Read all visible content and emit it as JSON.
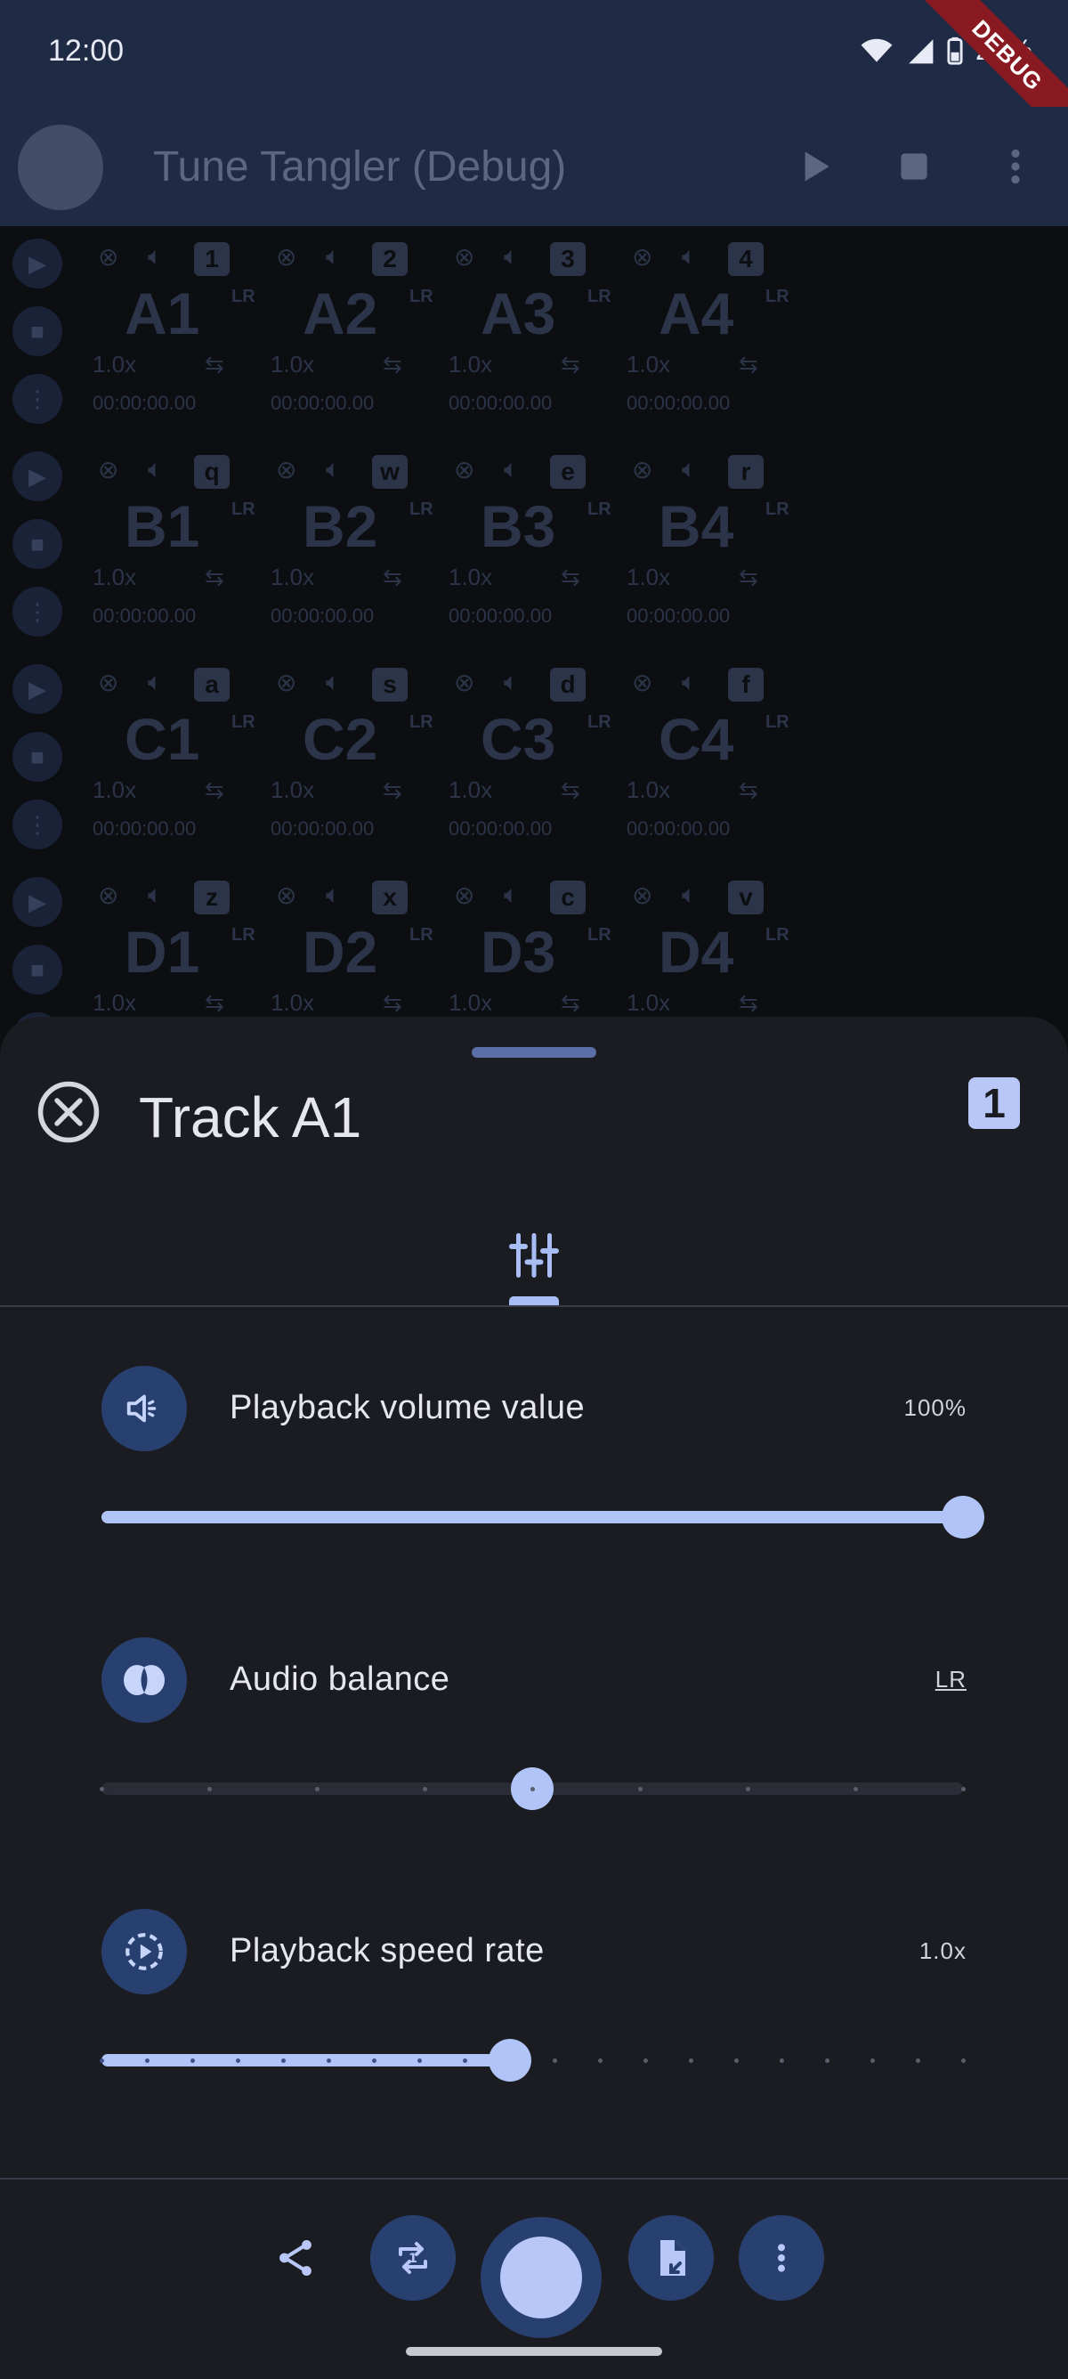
{
  "status_bar": {
    "time": "12:00",
    "battery": "26%",
    "debug_banner": "DEBUG"
  },
  "app_bar": {
    "title": "Tune Tangler (Debug)",
    "logo_text": "Tune Tangler"
  },
  "pads": [
    {
      "name": "A1",
      "key": "1",
      "speed": "1.0x",
      "time": "00:00:00.00",
      "balance": "LR"
    },
    {
      "name": "A2",
      "key": "2",
      "speed": "1.0x",
      "time": "00:00:00.00",
      "balance": "LR"
    },
    {
      "name": "A3",
      "key": "3",
      "speed": "1.0x",
      "time": "00:00:00.00",
      "balance": "LR"
    },
    {
      "name": "A4",
      "key": "4",
      "speed": "1.0x",
      "time": "00:00:00.00",
      "balance": "LR"
    },
    {
      "name": "B1",
      "key": "q",
      "speed": "1.0x",
      "time": "00:00:00.00",
      "balance": "LR"
    },
    {
      "name": "B2",
      "key": "w",
      "speed": "1.0x",
      "time": "00:00:00.00",
      "balance": "LR"
    },
    {
      "name": "B3",
      "key": "e",
      "speed": "1.0x",
      "time": "00:00:00.00",
      "balance": "LR"
    },
    {
      "name": "B4",
      "key": "r",
      "speed": "1.0x",
      "time": "00:00:00.00",
      "balance": "LR"
    },
    {
      "name": "C1",
      "key": "a",
      "speed": "1.0x",
      "time": "00:00:00.00",
      "balance": "LR"
    },
    {
      "name": "C2",
      "key": "s",
      "speed": "1.0x",
      "time": "00:00:00.00",
      "balance": "LR"
    },
    {
      "name": "C3",
      "key": "d",
      "speed": "1.0x",
      "time": "00:00:00.00",
      "balance": "LR"
    },
    {
      "name": "C4",
      "key": "f",
      "speed": "1.0x",
      "time": "00:00:00.00",
      "balance": "LR"
    },
    {
      "name": "D1",
      "key": "z",
      "speed": "1.0x",
      "time": "",
      "balance": "LR"
    },
    {
      "name": "D2",
      "key": "x",
      "speed": "1.0x",
      "time": "",
      "balance": "LR"
    },
    {
      "name": "D3",
      "key": "c",
      "speed": "1.0x",
      "time": "",
      "balance": "LR"
    },
    {
      "name": "D4",
      "key": "v",
      "speed": "1.0x",
      "time": "",
      "balance": "LR"
    }
  ],
  "sheet": {
    "title": "Track A1",
    "key": "1",
    "settings": {
      "volume": {
        "label": "Playback volume value",
        "value": "100%",
        "level": 1.0,
        "icon": "volume-icon"
      },
      "balance": {
        "label": "Audio balance",
        "value": "LR",
        "level": 0.5,
        "steps": 8,
        "icon": "balance-icon"
      },
      "speed": {
        "label": "Playback speed rate",
        "value": "1.0x",
        "level": 0.474,
        "steps": 19,
        "icon": "speed-icon"
      }
    }
  },
  "colors": {
    "accent": "#b0c4f7",
    "surface": "#1b1c21",
    "app_bar": "#1f2a44"
  }
}
